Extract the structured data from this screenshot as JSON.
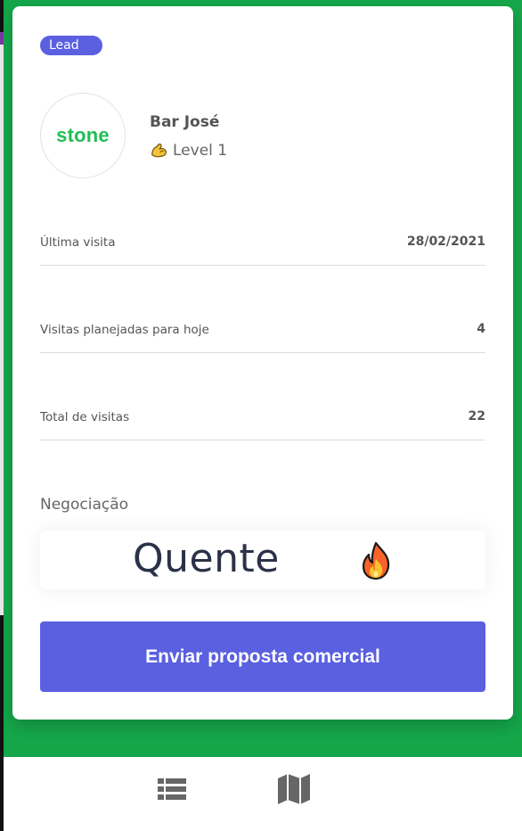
{
  "badge": {
    "label": "Lead"
  },
  "profile": {
    "logo_text": "stone",
    "name": "Bar José",
    "level": "Level 1",
    "level_icon": "flexed-biceps-icon"
  },
  "stats": [
    {
      "label": "Última visita",
      "value": "28/02/2021"
    },
    {
      "label": "Visitas planejadas para hoje",
      "value": "4"
    },
    {
      "label": "Total de visitas",
      "value": "22"
    }
  ],
  "negotiation": {
    "label": "Negociação",
    "value": "Quente",
    "icon": "fire-icon"
  },
  "cta": {
    "label": "Enviar proposta comercial"
  },
  "bottom_nav": {
    "items": [
      {
        "icon": "list-icon"
      },
      {
        "icon": "map-icon"
      }
    ]
  },
  "colors": {
    "accent": "#5a60e0",
    "background_green": "#15a64a",
    "logo_green": "#1ebf54"
  }
}
